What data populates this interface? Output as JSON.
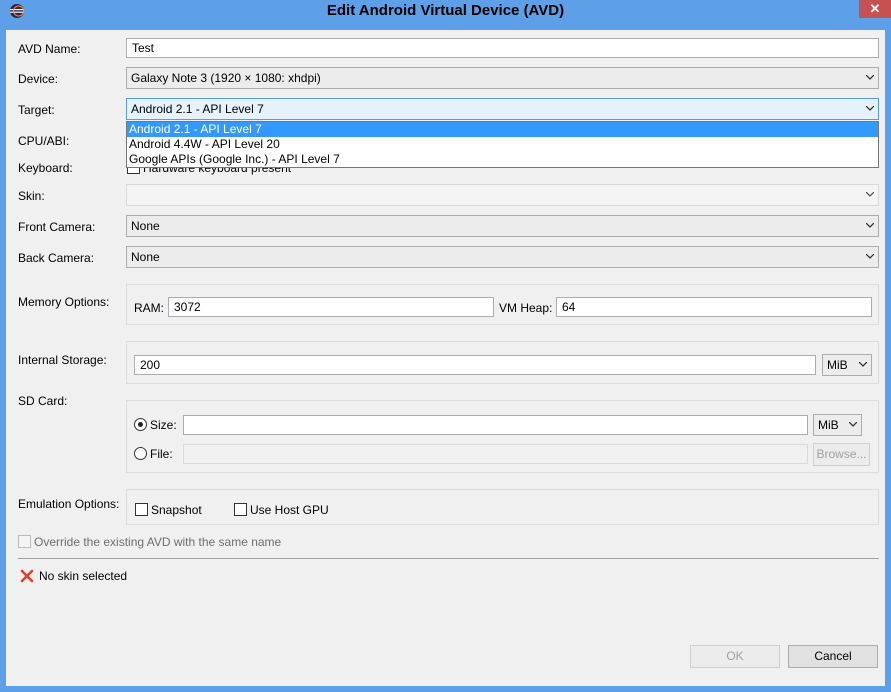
{
  "window": {
    "title": "Edit Android Virtual Device (AVD)",
    "close_glyph": "✕"
  },
  "labels": {
    "avd_name": "AVD Name:",
    "device": "Device:",
    "target": "Target:",
    "cpu_abi": "CPU/ABI:",
    "keyboard": "Keyboard:",
    "skin": "Skin:",
    "front_camera": "Front Camera:",
    "back_camera": "Back Camera:",
    "memory_options": "Memory Options:",
    "ram": "RAM:",
    "vm_heap": "VM Heap:",
    "internal_storage": "Internal Storage:",
    "sd_card": "SD Card:",
    "size": "Size:",
    "file": "File:",
    "emulation_options": "Emulation Options:"
  },
  "fields": {
    "avd_name": "Test",
    "device": "Galaxy Note 3 (1920 × 1080: xhdpi)",
    "target": "Android 2.1 - API Level 7",
    "skin": "",
    "front_camera": "None",
    "back_camera": "None",
    "ram": "3072",
    "vm_heap": "64",
    "internal_storage": "200",
    "internal_storage_unit": "MiB",
    "sd_size": "",
    "sd_size_unit": "MiB",
    "sd_file": ""
  },
  "keyboard_checkbox": "Hardware keyboard present",
  "target_options": [
    "Android 2.1 - API Level 7",
    "Android 4.4W - API Level 20",
    "Google APIs (Google Inc.) - API Level 7"
  ],
  "buttons": {
    "browse": "Browse...",
    "ok": "OK",
    "cancel": "Cancel"
  },
  "emulation": {
    "snapshot": "Snapshot",
    "use_host_gpu": "Use Host GPU"
  },
  "override_checkbox": "Override the existing AVD with the same name",
  "status": {
    "message": "No skin selected"
  },
  "colors": {
    "title_bar": "#5da0e8",
    "selection": "#3399ff",
    "error": "#e0402a",
    "close_button": "#c75050"
  }
}
